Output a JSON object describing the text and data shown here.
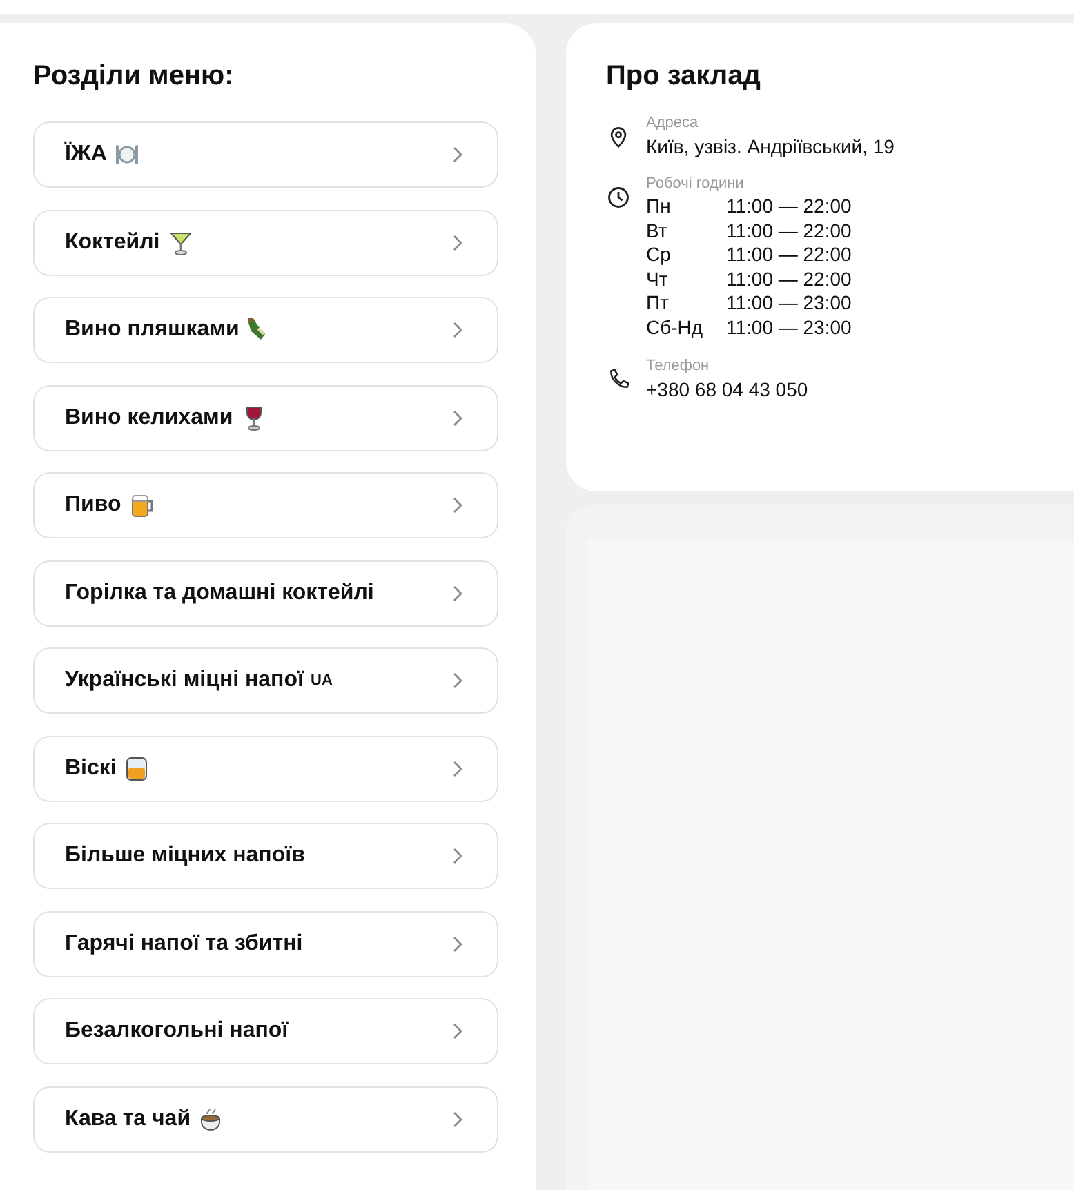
{
  "menu": {
    "title": "Розділи меню:",
    "items": [
      {
        "label": "ЇЖА"
      },
      {
        "label": "Коктейлі"
      },
      {
        "label": "Вино пляшками"
      },
      {
        "label": "Вино келихами"
      },
      {
        "label": "Пиво"
      },
      {
        "label": "Горілка та домашні коктейлі"
      },
      {
        "label": "Українські міцні напої",
        "badge": "UA"
      },
      {
        "label": "Віскі"
      },
      {
        "label": "Більше міцних напоїв"
      },
      {
        "label": "Гарячі напої та збитні"
      },
      {
        "label": "Безалкогольні напої"
      },
      {
        "label": "Кава та чай"
      }
    ]
  },
  "about": {
    "title": "Про заклад",
    "address": {
      "label": "Адреса",
      "value": "Київ, узвіз. Андріївський, 19"
    },
    "hours": {
      "label": "Робочі години",
      "rows": [
        {
          "day": "Пн",
          "time": "11:00 — 22:00"
        },
        {
          "day": "Вт",
          "time": "11:00 — 22:00"
        },
        {
          "day": "Ср",
          "time": "11:00 — 22:00"
        },
        {
          "day": "Чт",
          "time": "11:00 — 22:00"
        },
        {
          "day": "Пт",
          "time": "11:00 — 23:00"
        },
        {
          "day": "Сб-Нд",
          "time": "11:00 — 23:00"
        }
      ]
    },
    "phone": {
      "label": "Телефон",
      "value": "+380 68 04 43 050"
    }
  }
}
